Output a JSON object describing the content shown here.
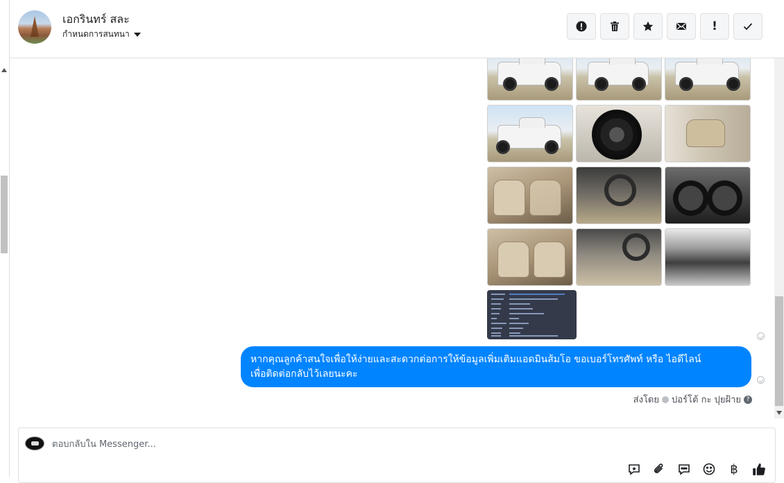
{
  "contact": {
    "name": "เอกรินทร์ สละ",
    "status_label": "กำหนดการสนทนา"
  },
  "header_actions": [
    {
      "name": "mark-important-button",
      "icon": "exclamation-circle-icon"
    },
    {
      "name": "delete-button",
      "icon": "trash-icon"
    },
    {
      "name": "star-button",
      "icon": "star-icon"
    },
    {
      "name": "mark-unread-button",
      "icon": "envelope-icon"
    },
    {
      "name": "flag-spam-button",
      "icon": "exclamation-icon"
    },
    {
      "name": "mark-done-button",
      "icon": "check-icon"
    }
  ],
  "message": {
    "text_line1": "หากคุณลูกค้าสนใจเพื่อให้ง่ายและสะดวกต่อการให้ข้อมูลเพิ่มเติมแอดมินส้มโอ ขอเบอร์โทรศัพท์ หรือ ไอดีไลน์",
    "text_line2": "เพื่อติดต่อกลับไว้เลยนะคะ"
  },
  "sent_by": {
    "prefix": "ส่งโดย",
    "agent": "ปอร์โต้ กะ ปุยฝ้าย"
  },
  "composer": {
    "placeholder": "ตอบกลับใน Messenger...",
    "tools": [
      "saved-reply-icon",
      "attachment-icon",
      "chat-bubble-icon",
      "emoji-icon",
      "baht-icon",
      "thumbs-up-icon"
    ],
    "baht_symbol": "฿"
  },
  "colors": {
    "accent": "#0084ff",
    "border": "#dddfe2"
  }
}
